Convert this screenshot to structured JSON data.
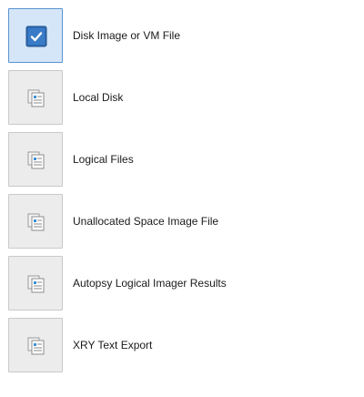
{
  "options": [
    {
      "label": "Disk Image or VM File",
      "selected": true,
      "icon": "checkbox-checked-icon"
    },
    {
      "label": "Local Disk",
      "selected": false,
      "icon": "documents-icon"
    },
    {
      "label": "Logical Files",
      "selected": false,
      "icon": "documents-icon"
    },
    {
      "label": "Unallocated Space Image File",
      "selected": false,
      "icon": "documents-icon"
    },
    {
      "label": "Autopsy Logical Imager Results",
      "selected": false,
      "icon": "documents-icon"
    },
    {
      "label": "XRY Text Export",
      "selected": false,
      "icon": "documents-icon"
    }
  ],
  "colors": {
    "selected_border": "#5a93d2",
    "selected_fill": "#d5e6f8",
    "check_fill": "#2f6db5",
    "button_fill": "#ececec",
    "button_border": "#c9c9c9"
  }
}
